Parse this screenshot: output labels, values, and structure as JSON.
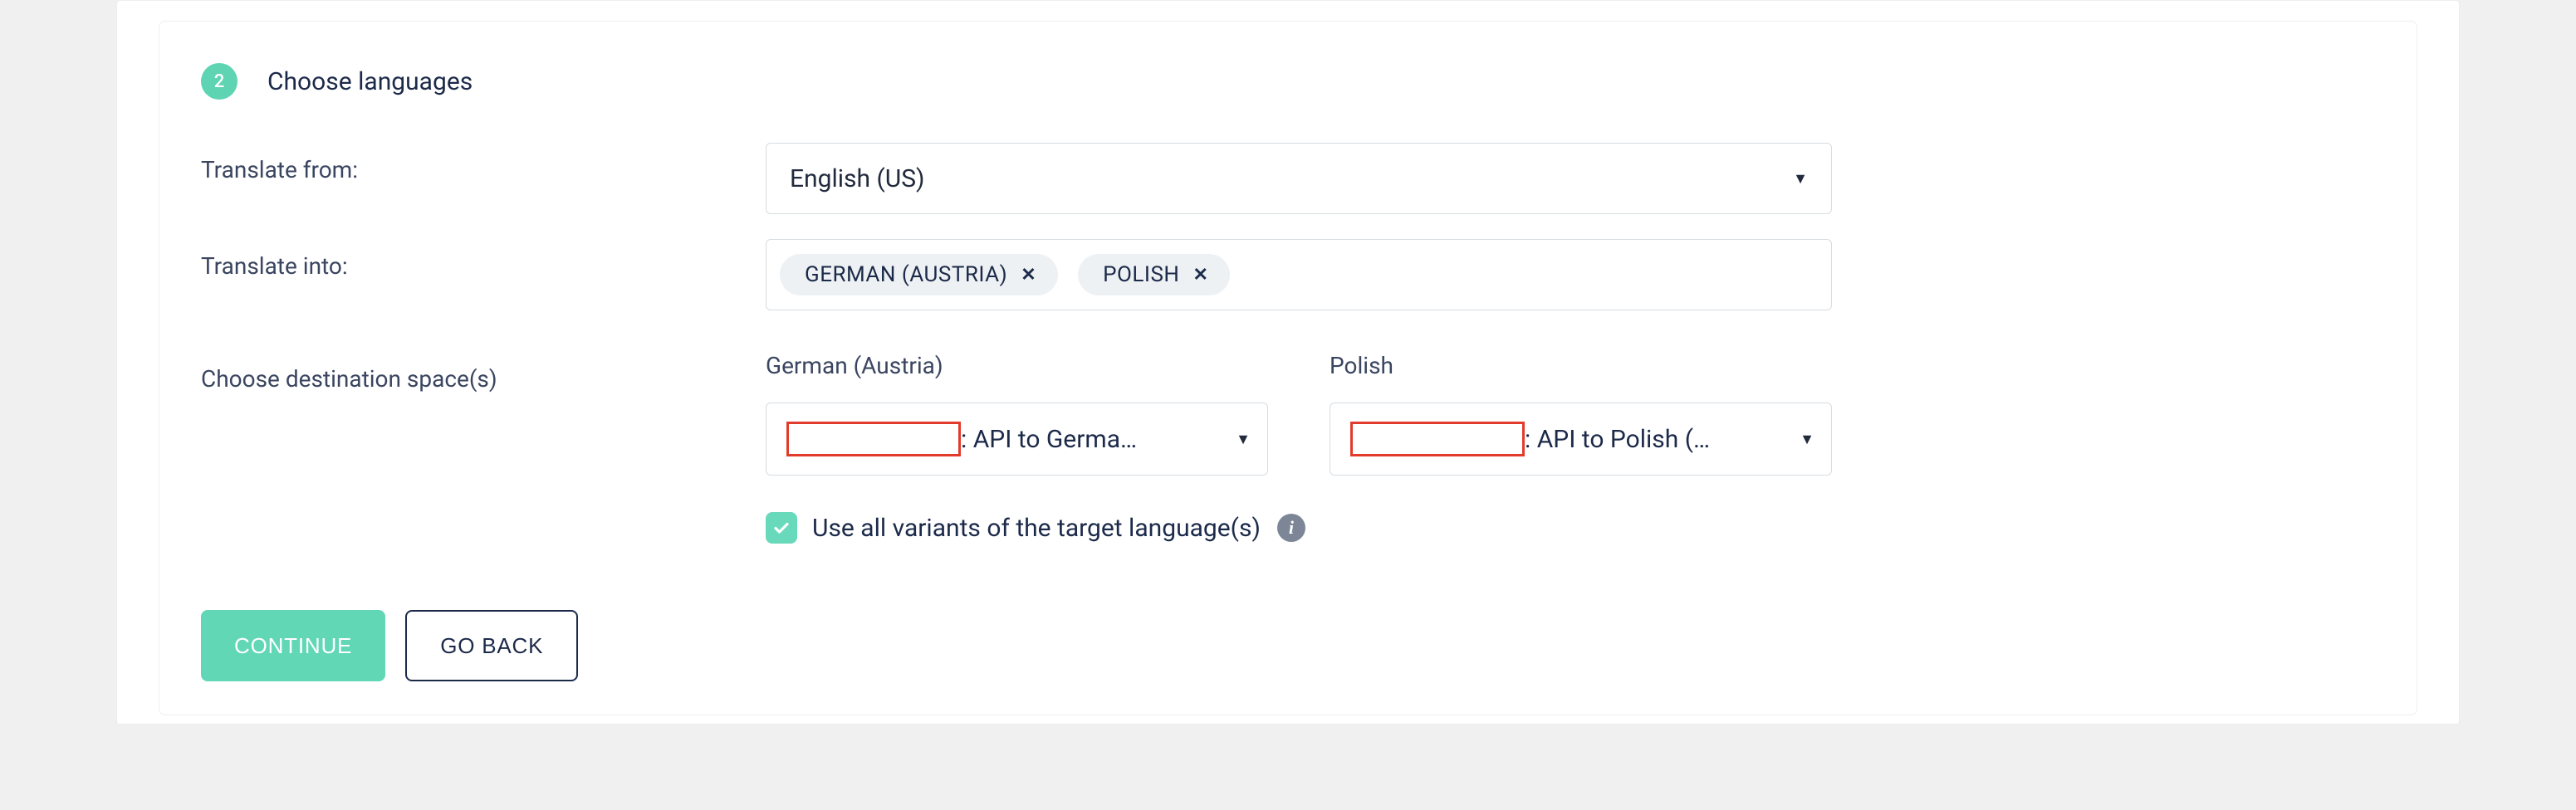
{
  "step": {
    "number": "2",
    "title": "Choose languages"
  },
  "labels": {
    "translate_from": "Translate from:",
    "translate_into": "Translate into:",
    "destination": "Choose destination space(s)"
  },
  "source_language": {
    "selected": "English (US)"
  },
  "target_languages": [
    {
      "label": "GERMAN (AUSTRIA)"
    },
    {
      "label": "POLISH"
    }
  ],
  "destinations": [
    {
      "lang_label": "German (Austria)",
      "space_value": ": API to Germa…"
    },
    {
      "lang_label": "Polish",
      "space_value": ": API to Polish (…"
    }
  ],
  "use_all_variants": {
    "checked": true,
    "label": "Use all variants of the target language(s)"
  },
  "buttons": {
    "continue": "CONTINUE",
    "go_back": "GO BACK"
  }
}
